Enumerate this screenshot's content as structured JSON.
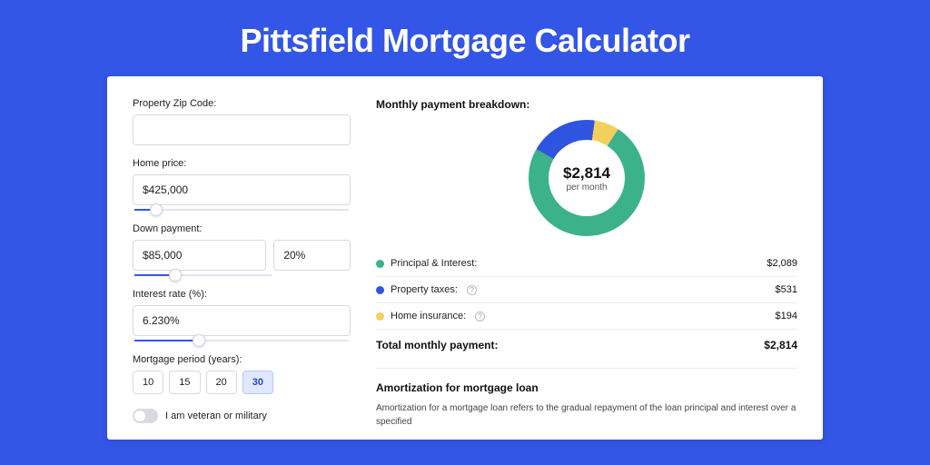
{
  "title": "Pittsfield Mortgage Calculator",
  "form": {
    "zip_label": "Property Zip Code:",
    "zip_value": "",
    "home_price_label": "Home price:",
    "home_price_value": "$425,000",
    "down_payment_label": "Down payment:",
    "down_payment_value": "$85,000",
    "down_payment_pct": "20%",
    "interest_label": "Interest rate (%):",
    "interest_value": "6.230%",
    "period_label": "Mortgage period (years):",
    "period_options": [
      "10",
      "15",
      "20",
      "30"
    ],
    "period_selected": "30",
    "veteran_label": "I am veteran or military",
    "veteran_on": false
  },
  "breakdown": {
    "heading": "Monthly payment breakdown:",
    "center_value": "$2,814",
    "center_sub": "per month",
    "items": [
      {
        "name": "Principal & Interest:",
        "value": "$2,089",
        "color": "#3bb28a",
        "info": false
      },
      {
        "name": "Property taxes:",
        "value": "$531",
        "color": "#2f55e0",
        "info": true
      },
      {
        "name": "Home insurance:",
        "value": "$194",
        "color": "#f3cf5e",
        "info": true
      }
    ],
    "total_label": "Total monthly payment:",
    "total_value": "$2,814"
  },
  "chart_data": {
    "type": "pie",
    "title": "Monthly payment breakdown",
    "series": [
      {
        "name": "Principal & Interest",
        "value": 2089,
        "color": "#3bb28a"
      },
      {
        "name": "Property taxes",
        "value": 531,
        "color": "#2f55e0"
      },
      {
        "name": "Home insurance",
        "value": 194,
        "color": "#f3cf5e"
      }
    ],
    "total": 2814
  },
  "amortization": {
    "heading": "Amortization for mortgage loan",
    "body": "Amortization for a mortgage loan refers to the gradual repayment of the loan principal and interest over a specified"
  }
}
